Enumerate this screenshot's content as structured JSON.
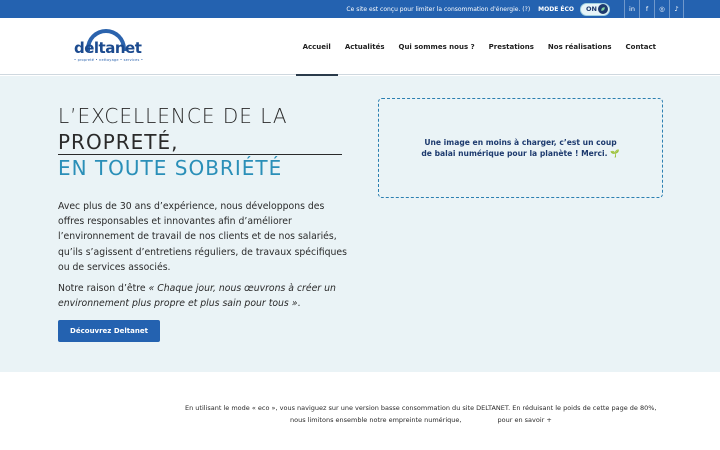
{
  "topbar": {
    "eco_text": "Ce site est conçu pour limiter la consommation d'énergie. (?)",
    "eco_label": "MODE ÉCO",
    "toggle_state": "ON",
    "social": [
      "in",
      "f",
      "◎",
      "♪"
    ],
    "bg_color": "#2462b0"
  },
  "header": {
    "logo_word": "deltanet",
    "logo_tagline": "• propreté • nettoyage • services •",
    "nav": [
      "Accueil",
      "Actualités",
      "Qui sommes nous ?",
      "Prestations",
      "Nos réalisations",
      "Contact"
    ],
    "active_nav": "Accueil"
  },
  "hero": {
    "title_line1": "L’EXCELLENCE DE LA",
    "title_line2": "PROPRETÉ,",
    "title_line3": "EN TOUTE SOBRIÉTÉ",
    "paragraph1": "Avec plus de 30 ans d’expérience, nous développons des offres responsables et innovantes afin d’améliorer l’environnement de travail de nos clients et de nos salariés, qu’ils s’agissent d’entretiens réguliers, de travaux spécifiques ou de services associés.",
    "paragraph2_prefix": "Notre raison d’être ",
    "paragraph2_quote": "« Chaque jour, nous œuvrons à créer un environnement plus propre et plus sain pour tous »",
    "paragraph2_suffix": ".",
    "cta_label": "Découvrez Deltanet",
    "image_placeholder": "Une image en moins à charger, c’est un coup de balai numérique pour la planète ! Merci. 🌱",
    "bg_color": "#eaf3f6",
    "accent_color": "#2a8fb8"
  },
  "footer_note": {
    "line1": "En utilisant le mode « eco », vous naviguez sur une version basse consommation du site DELTANET. En réduisant le poids de cette page de 80%,",
    "line2": "nous limitons ensemble notre empreinte numérique,",
    "more_label": "pour en savoir +"
  }
}
